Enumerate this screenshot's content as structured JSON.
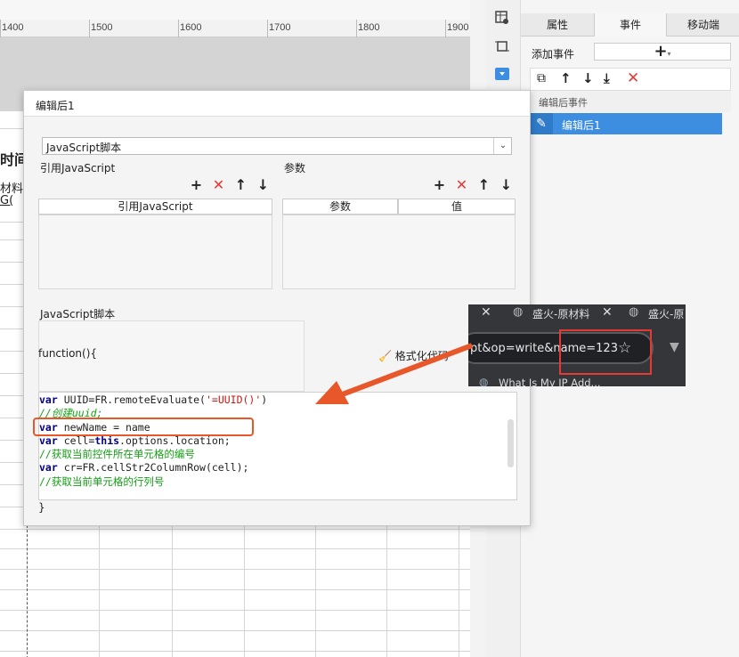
{
  "ruler": {
    "marks": [
      "1400",
      "1500",
      "1600",
      "1700",
      "1800",
      "1900"
    ]
  },
  "sheet": {
    "partial_title": "时间",
    "partial_row1": "材料",
    "partial_row2": "G("
  },
  "right_panel": {
    "tabs": [
      "属性",
      "事件",
      "移动端"
    ],
    "add_event_label": "添加事件",
    "add_button": "+",
    "section_label": "编辑后事件",
    "event_item": "编辑后1"
  },
  "dialog": {
    "title": "编辑后1",
    "type_select": "JavaScript脚本",
    "ref_js_label": "引用JavaScript",
    "params_label": "参数",
    "ref_js_column": "引用JavaScript",
    "param_columns": [
      "参数",
      "值"
    ],
    "script_label": "JavaScript脚本",
    "function_open": "function(){",
    "format_code": "格式化代码",
    "function_close": "}",
    "code_lines": [
      "var UUID=FR.remoteEvaluate('=UUID()')",
      "//创建uuid;",
      "var newName = name",
      "var cell=this.options.location;",
      "//获取当前控件所在单元格的编号",
      "var cr=FR.cellStr2ColumnRow(cell);",
      "//获取当前单元格的行列号"
    ]
  },
  "browser": {
    "tab1": "盛火-原材料",
    "tab2": "盛火-原",
    "url_fragment": "pt&op=write&name=123",
    "bookmark": "What Is My IP Add..."
  },
  "colors": {
    "selection": "#3d8ee0",
    "annotation": "#e8572a",
    "comment": "#14a014",
    "string": "#c41a16"
  }
}
